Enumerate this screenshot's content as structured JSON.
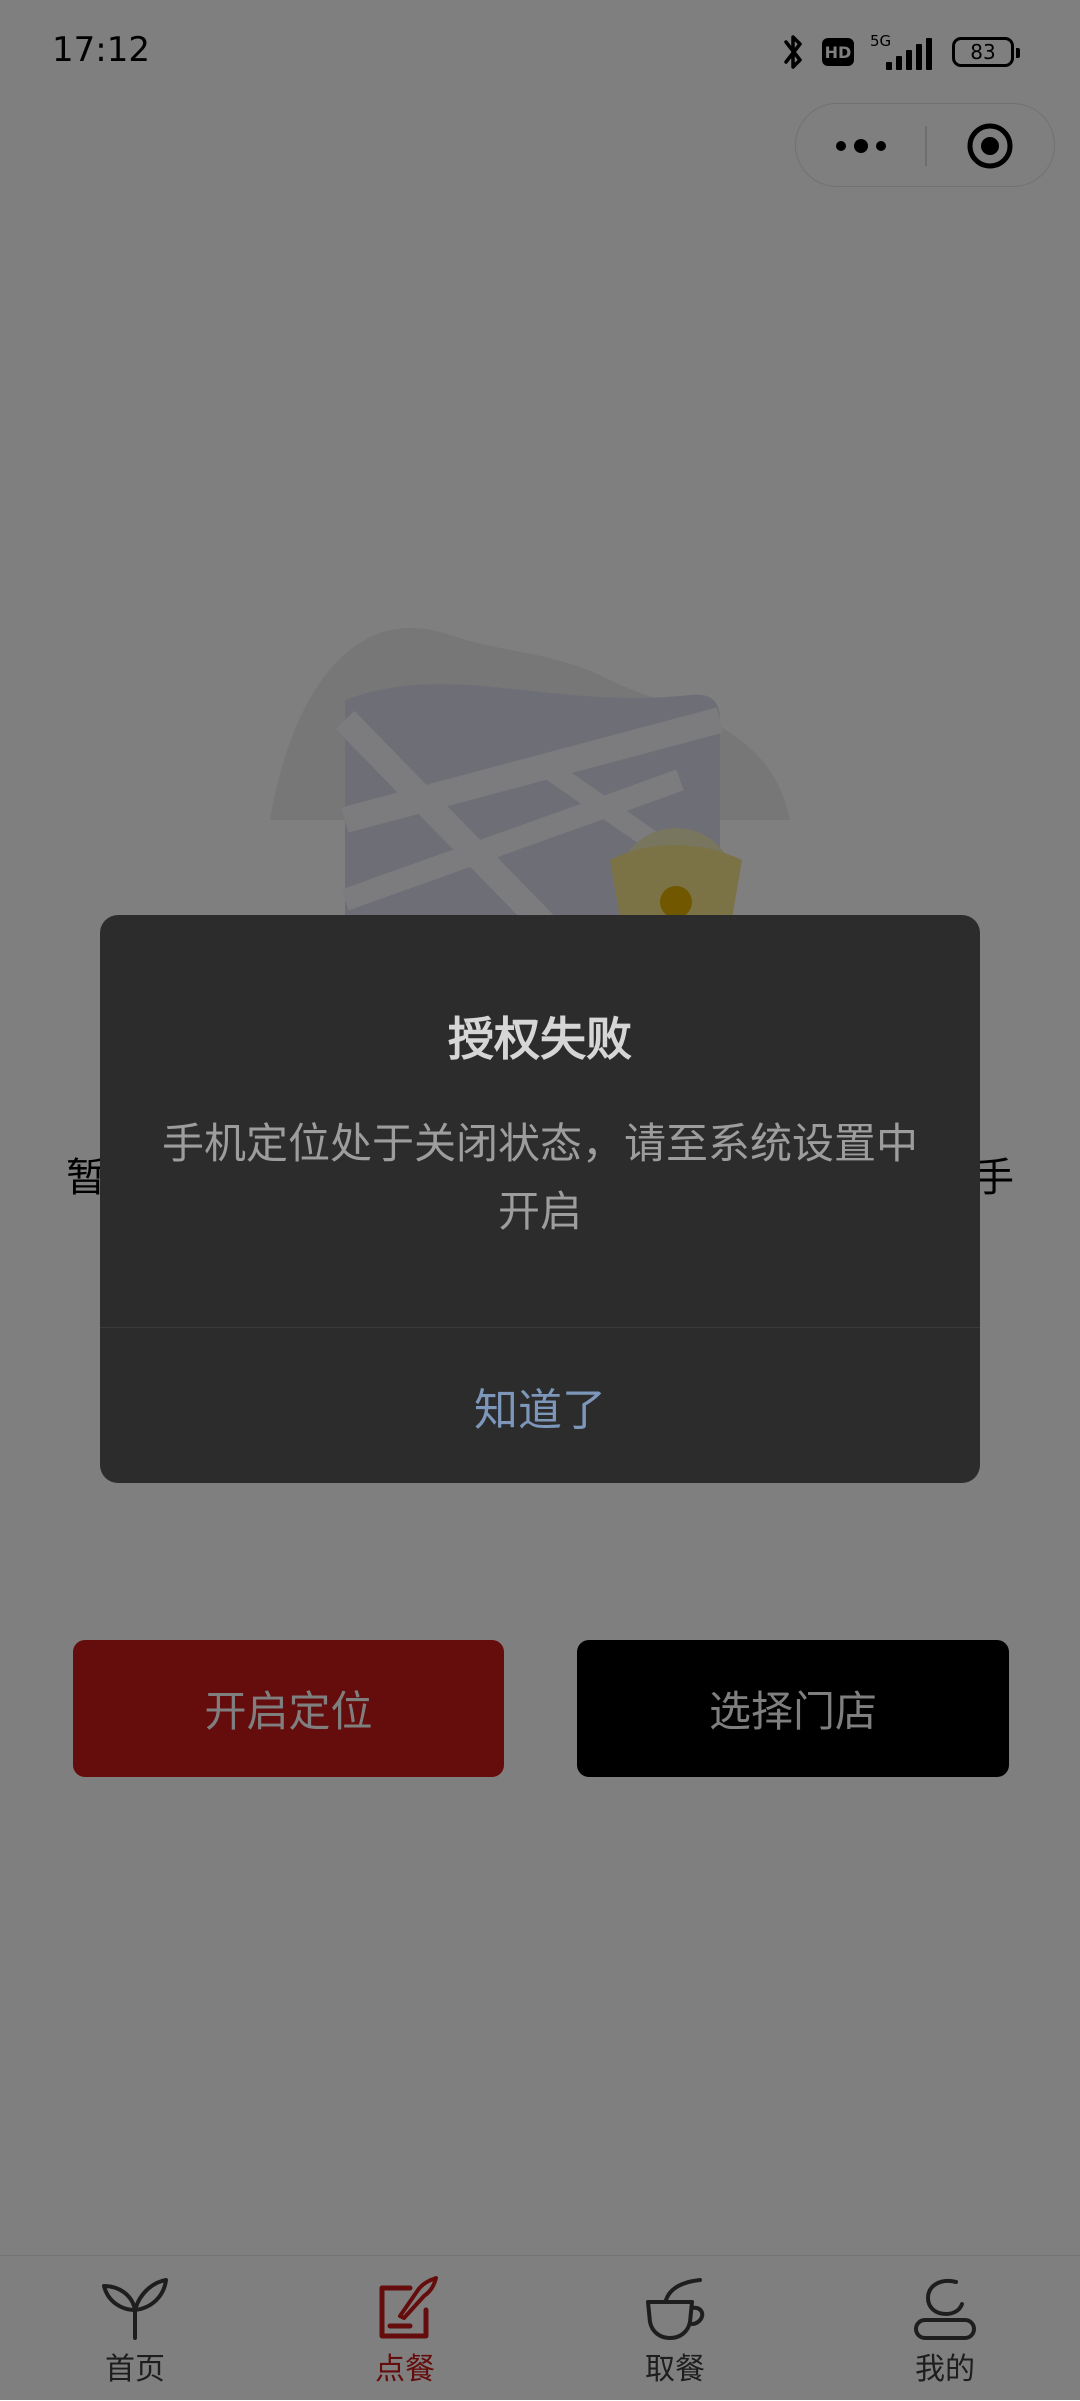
{
  "status_bar": {
    "time": "17:12",
    "hd_label": "HD",
    "network_label": "5G",
    "battery_level": "83"
  },
  "capsule": {
    "more_icon": "more-dots-icon",
    "close_icon": "target-circle-icon"
  },
  "content": {
    "illustration_icon": "map-location-icon",
    "message_left_glyph": "暂",
    "message_right_glyph": "手",
    "enable_location_label": "开启定位",
    "select_store_label": "选择门店"
  },
  "tabbar": {
    "items": [
      {
        "label": "首页",
        "icon": "sprout-icon",
        "active": false
      },
      {
        "label": "点餐",
        "icon": "order-icon",
        "active": true
      },
      {
        "label": "取餐",
        "icon": "cup-icon",
        "active": false
      },
      {
        "label": "我的",
        "icon": "user-icon",
        "active": false
      }
    ]
  },
  "dialog": {
    "title": "授权失败",
    "message": "手机定位处于关闭状态，请至系统设置中开启",
    "confirm_label": "知道了"
  },
  "colors": {
    "brand_red": "#ca1919",
    "mask": "rgba(0,0,0,0.5)",
    "dialog_bg": "#2c2c2c",
    "dialog_button": "#7d97ba"
  }
}
